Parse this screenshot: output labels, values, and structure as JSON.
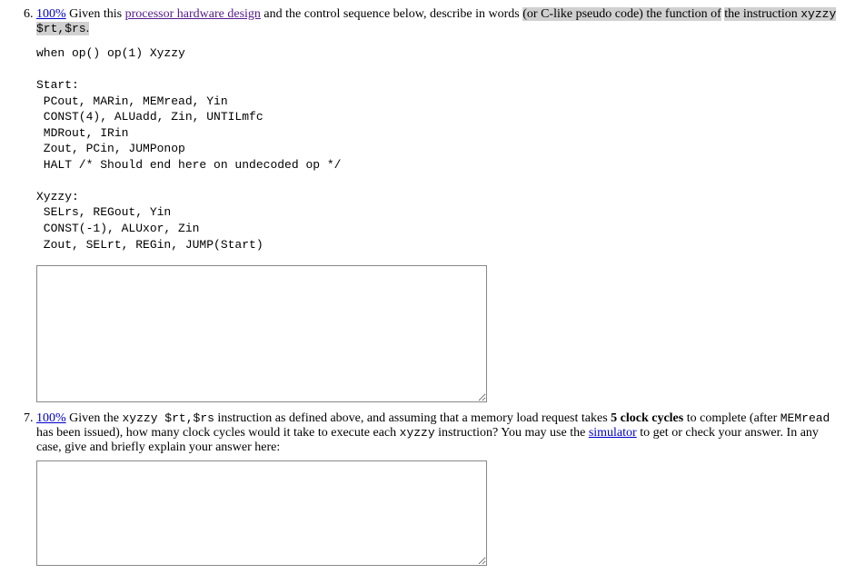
{
  "q6": {
    "number": "6.",
    "score_text": "100%",
    "text_a": " Given this ",
    "link1": "processor hardware design",
    "text_b": " and the control sequence below, describe in words ",
    "highlight_a": "(or C-like pseudo code) the function of",
    "highlight_b": "the instruction ",
    "inst": "xyzzy $rt,$rs",
    "highlight_c": ".",
    "code": "when op() op(1) Xyzzy\n\nStart:\n PCout, MARin, MEMread, Yin\n CONST(4), ALUadd, Zin, UNTILmfc\n MDRout, IRin\n Zout, PCin, JUMPonop\n HALT /* Should end here on undecoded op */\n\nXyzzy:\n SELrs, REGout, Yin\n CONST(-1), ALUxor, Zin\n Zout, SELrt, REGin, JUMP(Start)"
  },
  "q7": {
    "number": "7.",
    "score_text": "100%",
    "text_a": " Given the ",
    "inst": "xyzzy $rt,$rs",
    "text_b": " instruction as defined above, and assuming that a memory load request takes ",
    "bold1": "5 clock cycles",
    "text_c": " to complete (after ",
    "code1": "MEMread",
    "text_d": " has been issued), how many clock cycles would it take to execute each ",
    "code2": "xyzzy",
    "text_e": " instruction? You may use the ",
    "link1": "simulator",
    "text_f": " to get or check your answer. In any case, give and briefly explain your answer here:"
  }
}
